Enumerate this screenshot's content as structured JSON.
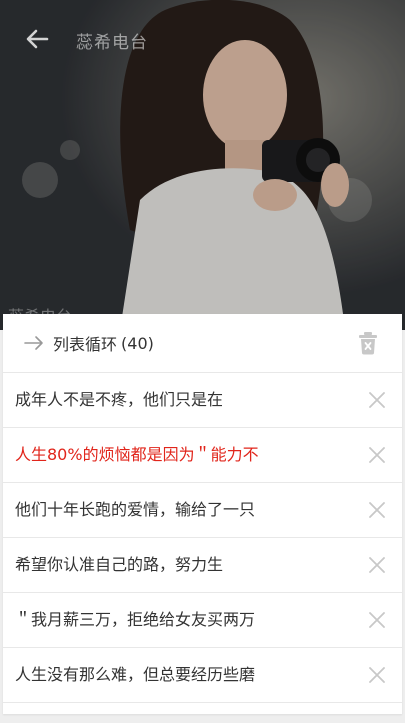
{
  "header": {
    "app_title": "蕊希电台",
    "caption": "蕊希电台"
  },
  "playlist": {
    "mode_label": "列表循环",
    "count_text": "(40)",
    "items": [
      {
        "title": "成年人不是不疼，他们只是在",
        "active": false
      },
      {
        "title": "人生80%的烦恼都是因为＂能力不",
        "active": true
      },
      {
        "title": "他们十年长跑的爱情，输给了一只",
        "active": false
      },
      {
        "title": "希望你认准自己的路，努力生",
        "active": false
      },
      {
        "title": "＂我月薪三万，拒绝给女友买两万",
        "active": false
      },
      {
        "title": "人生没有那么难，但总要经历些磨",
        "active": false
      }
    ]
  },
  "colors": {
    "active_text": "#e1251b",
    "icon_gray": "#c8c8c8"
  },
  "icons": {
    "back": "arrow-left-icon",
    "mode": "arrow-right-icon",
    "clear": "trash-icon",
    "remove": "close-icon"
  }
}
